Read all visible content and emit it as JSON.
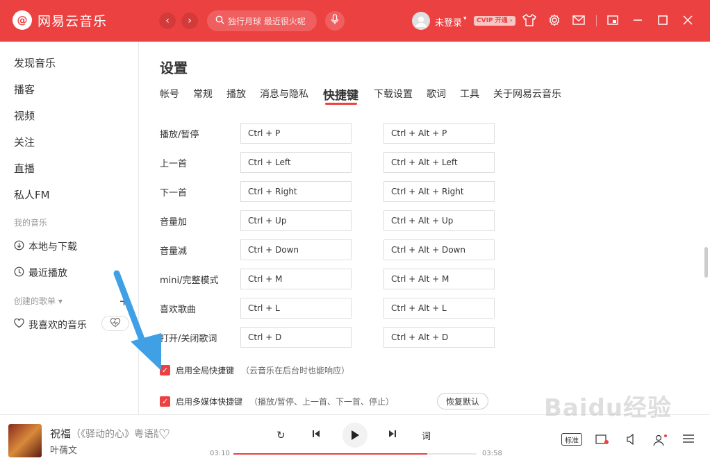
{
  "app": {
    "logo_symbol": "@",
    "name": "网易云音乐"
  },
  "topbar": {
    "back_glyph": "‹",
    "forward_glyph": "›",
    "search_placeholder": "独行月球 最近很火呢",
    "search_icon": "search-icon",
    "mic_icon": "microphone-icon",
    "user_label": "未登录",
    "user_caret": "▾",
    "vip_badge": "CVIP 开通 ›",
    "icons": [
      "skin-icon",
      "gear-icon",
      "mail-icon",
      "mini-mode-icon",
      "minimize-icon",
      "maximize-icon",
      "close-icon"
    ]
  },
  "sidebar": {
    "items": [
      "发现音乐",
      "播客",
      "视频",
      "关注",
      "直播",
      "私人FM"
    ],
    "section_mymusic": "我的音乐",
    "local_download": "本地与下载",
    "recent": "最近播放",
    "section_created": "创建的歌单 ▾",
    "add": "+",
    "liked": "我喜欢的音乐",
    "heartmode_icon": "heartbeat-mode-icon"
  },
  "settings": {
    "title": "设置",
    "tabs": [
      "帐号",
      "常规",
      "播放",
      "消息与隐私",
      "快捷键",
      "下载设置",
      "歌词",
      "工具",
      "关于网易云音乐"
    ],
    "active_tab": "快捷键",
    "shortcuts": [
      {
        "label": "播放/暂停",
        "local": "Ctrl + P",
        "global": "Ctrl + Alt + P"
      },
      {
        "label": "上一首",
        "local": "Ctrl + Left",
        "global": "Ctrl + Alt + Left"
      },
      {
        "label": "下一首",
        "local": "Ctrl + Right",
        "global": "Ctrl + Alt + Right"
      },
      {
        "label": "音量加",
        "local": "Ctrl + Up",
        "global": "Ctrl + Alt + Up"
      },
      {
        "label": "音量减",
        "local": "Ctrl + Down",
        "global": "Ctrl + Alt + Down"
      },
      {
        "label": "mini/完整模式",
        "local": "Ctrl + M",
        "global": "Ctrl + Alt + M"
      },
      {
        "label": "喜欢歌曲",
        "local": "Ctrl + L",
        "global": "Ctrl + Alt + L"
      },
      {
        "label": "打开/关闭歌词",
        "local": "Ctrl + D",
        "global": "Ctrl + Alt + D"
      }
    ],
    "global_hotkey": {
      "label": "启用全局快捷键",
      "note": "（云音乐在后台时也能响应）",
      "checked": true
    },
    "media_hotkey": {
      "label": "启用多媒体快捷键",
      "note": "（播放/暂停、上一首、下一首、停止）",
      "checked": true
    },
    "restore_default": "恢复默认",
    "check_glyph": "✓"
  },
  "player": {
    "title": "祝福",
    "subtitle": "（《驿动的心》粤语版）",
    "artist": "叶蒨文",
    "current_time": "03:10",
    "total_time": "03:58",
    "progress": 0.797,
    "lyrics_button": "词",
    "quality": "标准",
    "glyphs": {
      "loop": "↻",
      "prev": "⏮",
      "play": "▶",
      "next": "⏭",
      "like": "♡"
    },
    "right_icons": [
      "quality-icon",
      "effects-icon",
      "volume-icon",
      "listen-together-icon",
      "playlist-icon"
    ]
  },
  "watermark": "Baidu经验"
}
